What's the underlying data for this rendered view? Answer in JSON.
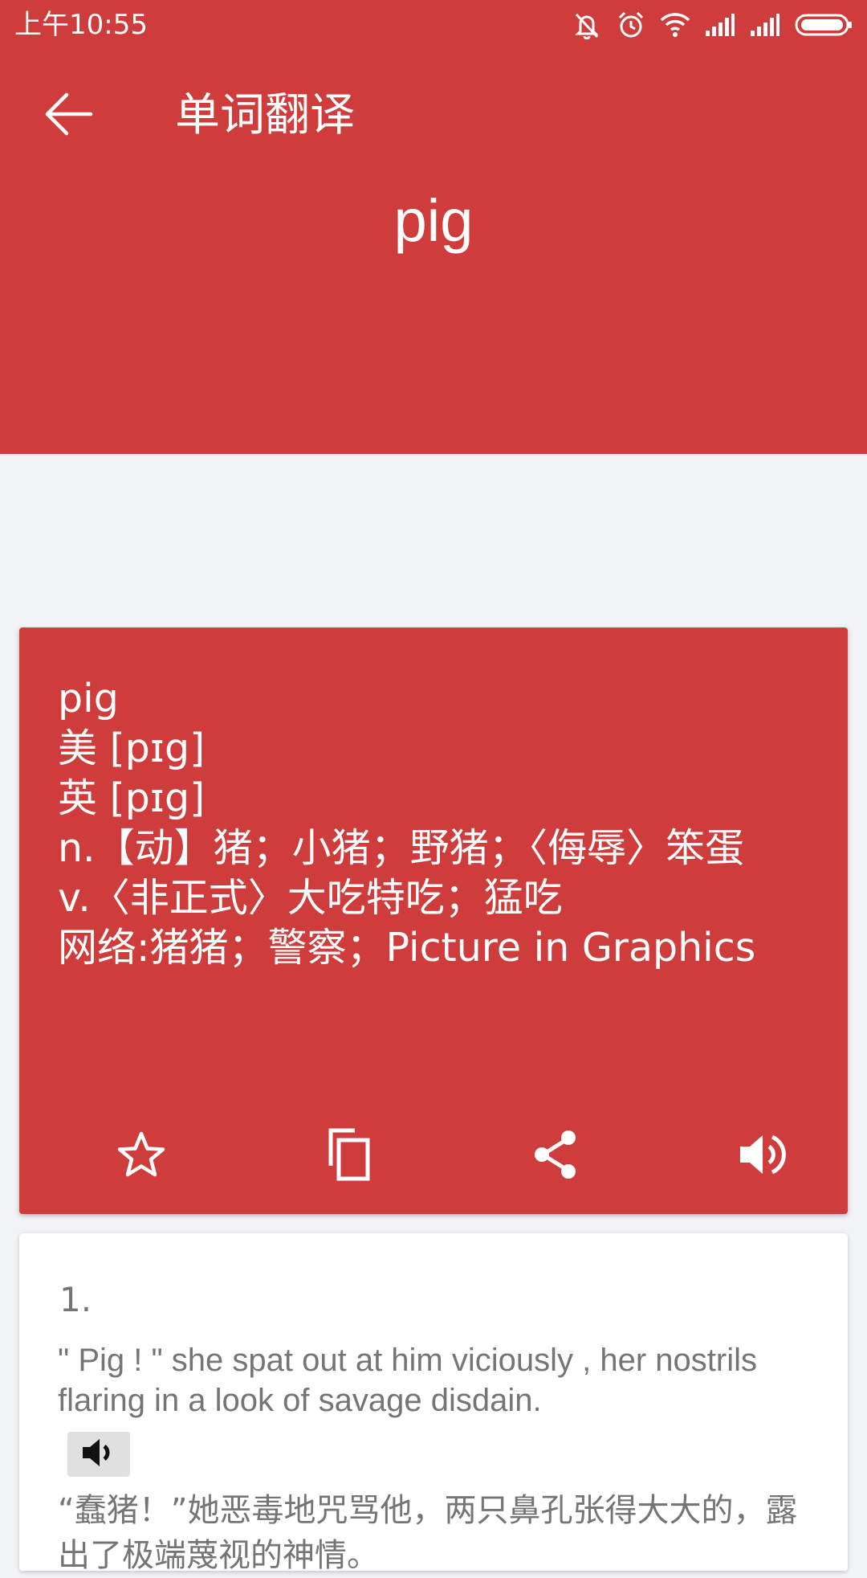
{
  "status_bar": {
    "time": "上午10:55",
    "icons": [
      "mute-vibrate-icon",
      "alarm-icon",
      "wifi-icon",
      "signal-icon",
      "signal-icon",
      "battery-icon"
    ]
  },
  "toolbar": {
    "back_icon": "arrow-back-icon",
    "title": "单词翻译"
  },
  "query": {
    "word": "pig"
  },
  "result": {
    "lines": [
      "pig",
      "美 [pɪg]",
      "英 [pɪg]",
      "n.【动】猪；小猪；野猪；〈侮辱〉笨蛋",
      "v.〈非正式〉大吃特吃；猛吃",
      "网络:猪猪；警察；Picture in Graphics"
    ],
    "actions": [
      "star-icon",
      "copy-icon",
      "share-icon",
      "volume-icon"
    ]
  },
  "examples": [
    {
      "number": "1.",
      "english": "\" Pig ! \"  she  spat out at him  viciously , her nostrils flaring in a  look  of  savage  disdain.",
      "chinese": "“蠢猪！”她恶毒地咒骂他，两只鼻孔张得大大的，露出了极端蔑视的神情。"
    }
  ],
  "colors": {
    "primary": "#ce3c3b",
    "background": "#f2f3f5",
    "card": "#ffffff",
    "text_secondary": "#757575"
  }
}
